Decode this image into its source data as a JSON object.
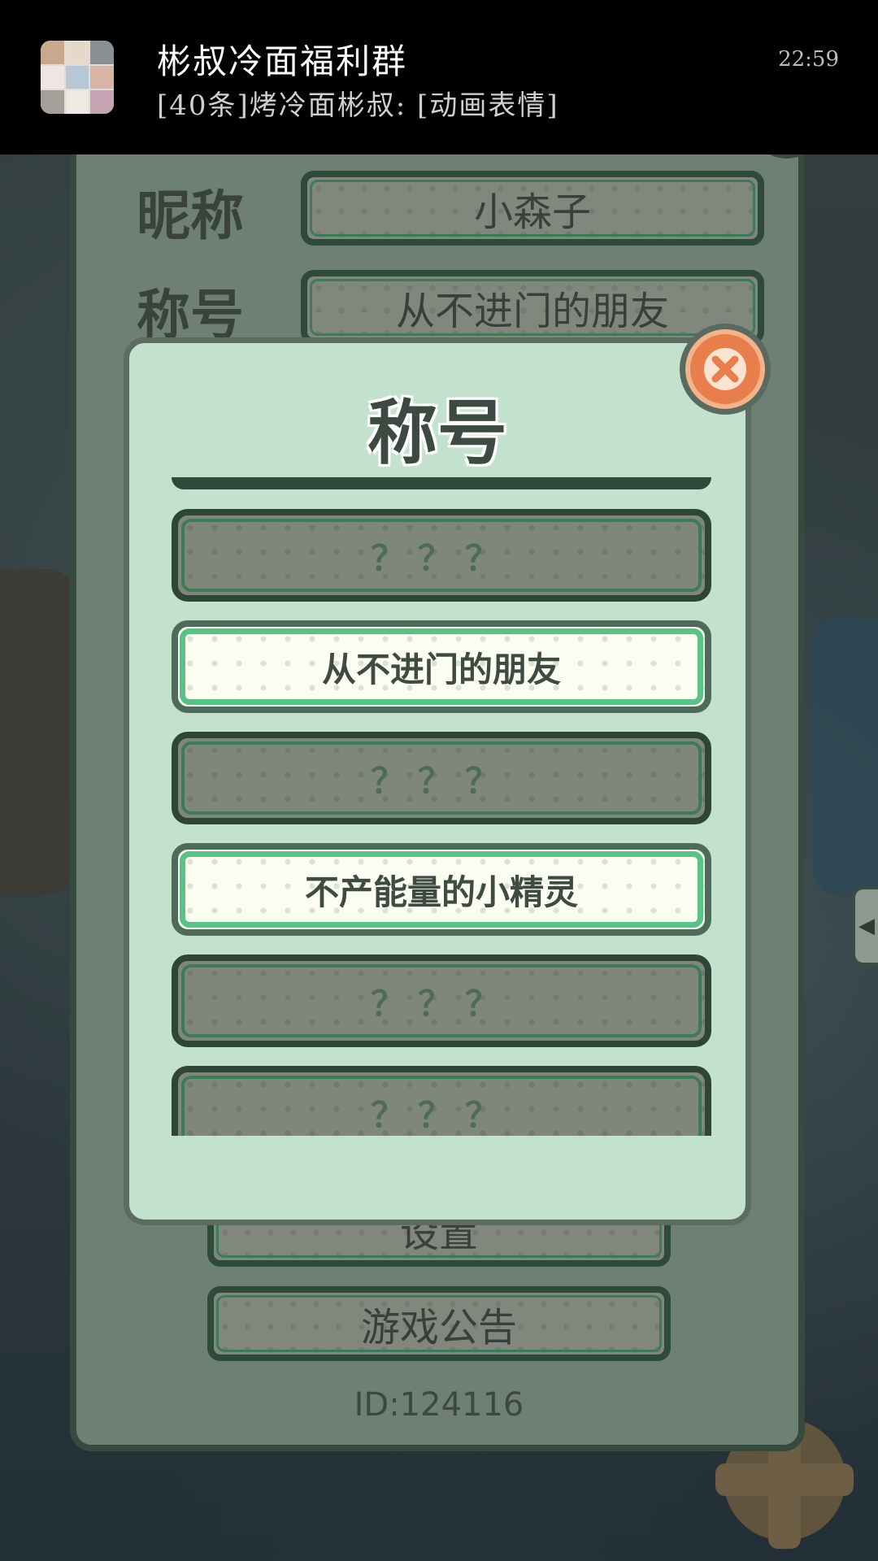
{
  "notification": {
    "group_name": "彬叔冷面福利群",
    "message": "[40条]烤冷面彬叔: [动画表情]",
    "time": "22:59"
  },
  "profile": {
    "nickname_label": "昵称",
    "nickname_value": "小森子",
    "title_label": "称号",
    "title_value": "从不进门的朋友",
    "settings_button": "设置",
    "announcement_button": "游戏公告",
    "id_text": "ID:124116"
  },
  "title_dialog": {
    "heading": "称号",
    "items": [
      {
        "label": "？？？",
        "unlocked": false
      },
      {
        "label": "从不进门的朋友",
        "unlocked": true
      },
      {
        "label": "？？？",
        "unlocked": false
      },
      {
        "label": "不产能量的小精灵",
        "unlocked": true
      },
      {
        "label": "？？？",
        "unlocked": false
      },
      {
        "label": "？？？",
        "unlocked": false
      }
    ]
  },
  "icons": {
    "close": "close-icon",
    "side_arrow": "chevron-left-icon"
  },
  "colors": {
    "dialog_bg": "#c3e2cd",
    "unlocked_border": "#58c287",
    "close_button": "#e77e4c"
  }
}
